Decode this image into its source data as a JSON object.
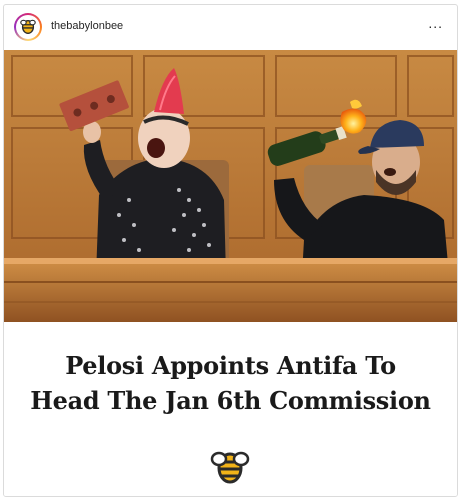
{
  "post": {
    "username": "thebabylonbee",
    "more_label": "...",
    "headline_line1": "Pelosi Appoints Antifa To",
    "headline_line2": "Head The Jan 6th Commission"
  },
  "icons": {
    "avatar": "bee-logo-icon",
    "more": "more-options-icon",
    "logo": "bee-logo-icon"
  },
  "colors": {
    "bee_yellow": "#f2b318",
    "bee_dark": "#2b2b2b",
    "wood": "#b7742f"
  }
}
